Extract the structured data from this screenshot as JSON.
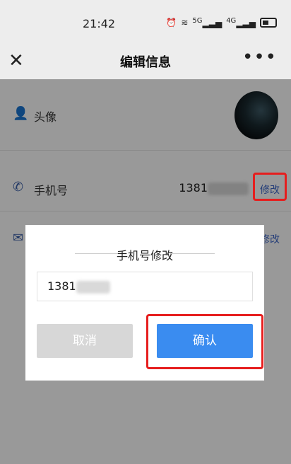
{
  "status_bar": {
    "time": "21:42",
    "signal_left": "5G",
    "signal_right": "4G"
  },
  "nav": {
    "title": "编辑信息",
    "more": "•••"
  },
  "rows": {
    "avatar_label": "头像",
    "phone_label": "手机号",
    "phone_value": "1381",
    "phone_edit": "修改",
    "email_edit": "修改"
  },
  "dialog": {
    "title": "手机号修改",
    "input_value": "1381",
    "cancel": "取消",
    "confirm": "确认"
  },
  "colors": {
    "accent": "#3a8cf0",
    "link": "#3c66c8",
    "highlight": "#e61e1e",
    "disabled": "#d7d7d7"
  }
}
